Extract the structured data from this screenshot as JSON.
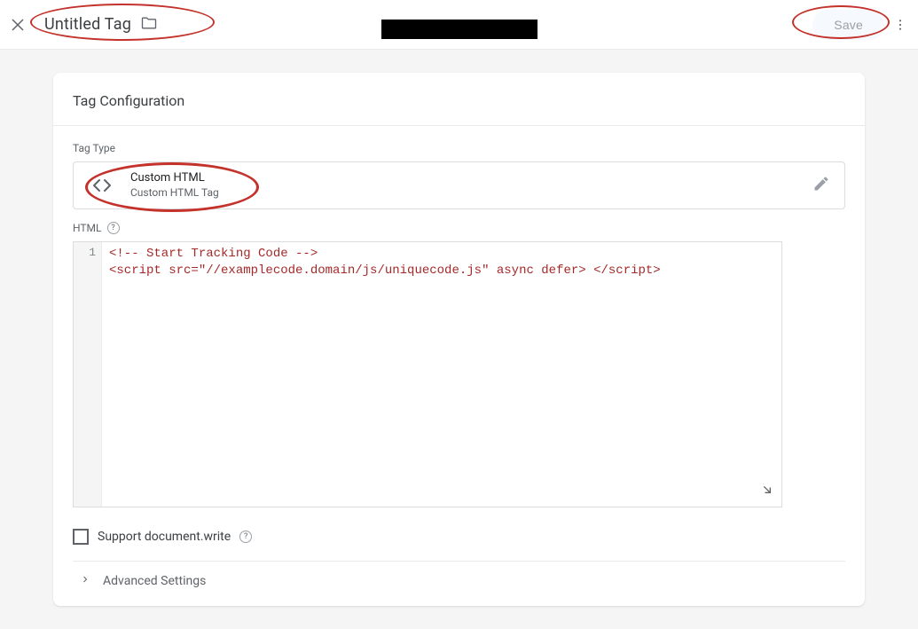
{
  "header": {
    "close_label": "×",
    "title": "Untitled Tag",
    "save_label": "Save"
  },
  "card": {
    "heading": "Tag Configuration",
    "tag_type_label": "Tag Type",
    "tag_type": {
      "name": "Custom HTML",
      "desc": "Custom HTML Tag"
    },
    "html_label": "HTML",
    "code_line1": "<!-- Start Tracking Code -->",
    "code_line2": "<script src=\"//examplecode.domain/js/uniquecode.js\" async defer> </script>",
    "gutter_1": "1",
    "support_label": "Support document.write",
    "advanced_label": "Advanced Settings"
  }
}
